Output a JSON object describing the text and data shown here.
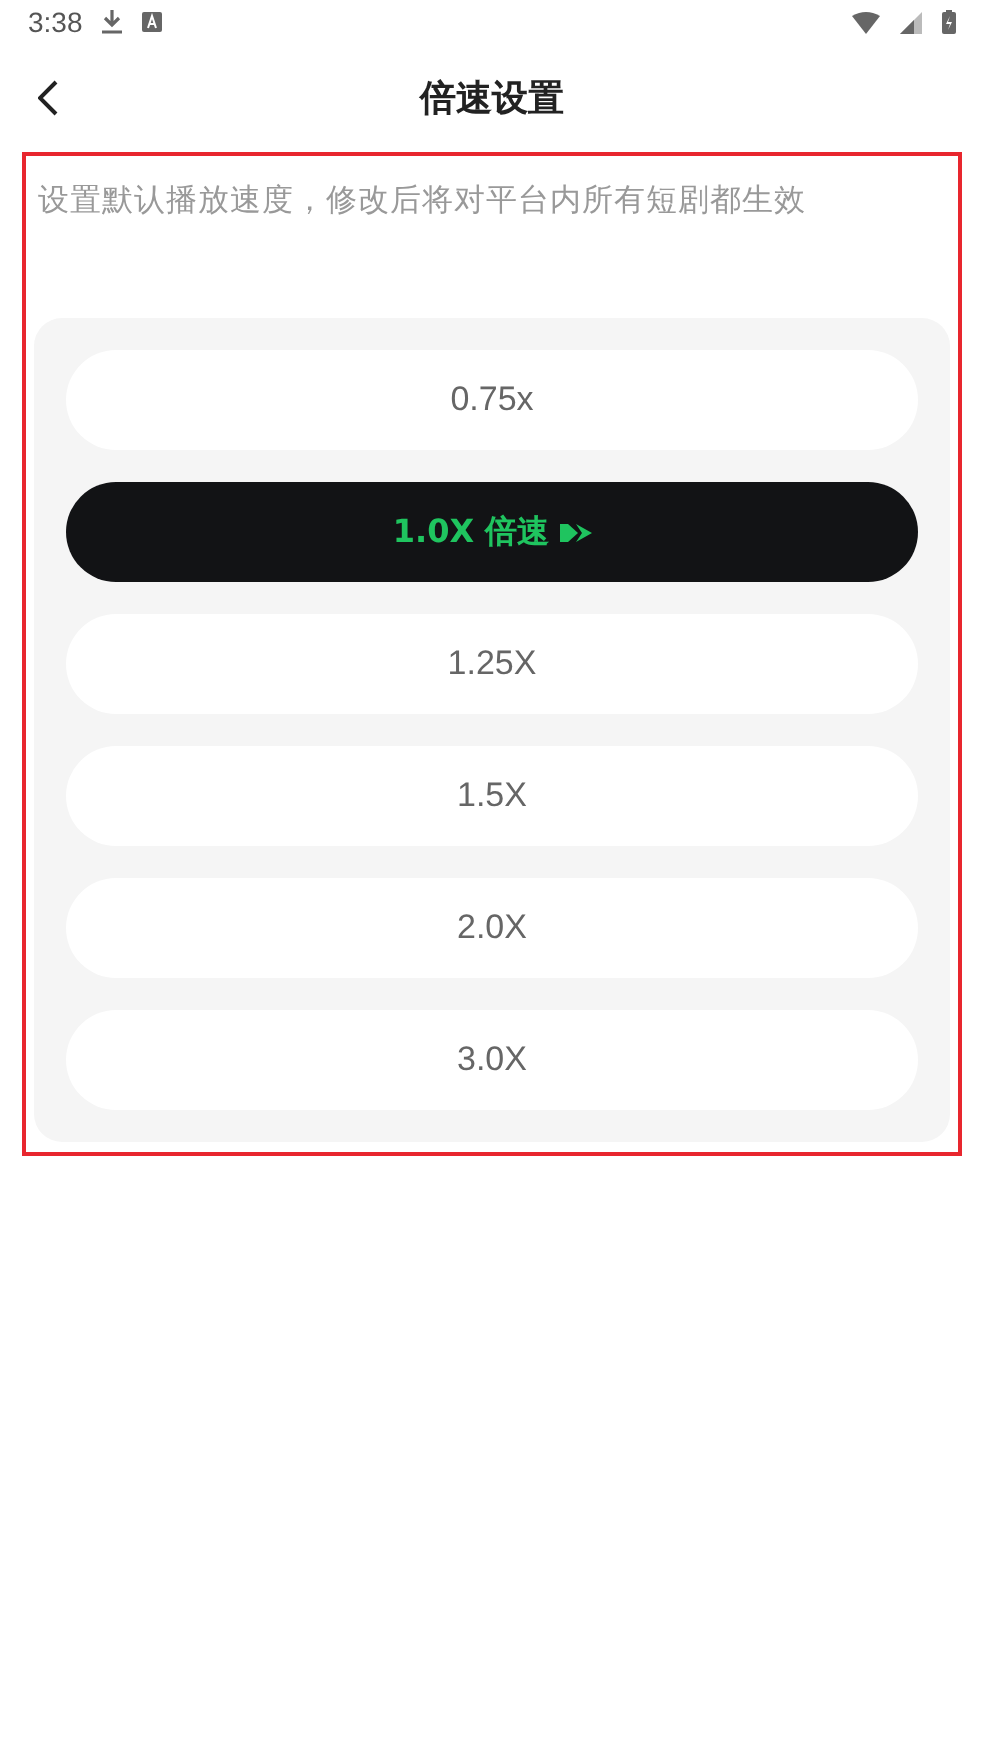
{
  "status_bar": {
    "time": "3:38"
  },
  "header": {
    "title": "倍速设置"
  },
  "description": "设置默认播放速度，修改后将对平台内所有短剧都生效",
  "speeds": [
    {
      "label": "0.75x",
      "selected": false
    },
    {
      "label": "1.0X 倍速",
      "selected": true
    },
    {
      "label": "1.25X",
      "selected": false
    },
    {
      "label": "1.5X",
      "selected": false
    },
    {
      "label": "2.0X",
      "selected": false
    },
    {
      "label": "3.0X",
      "selected": false
    }
  ]
}
